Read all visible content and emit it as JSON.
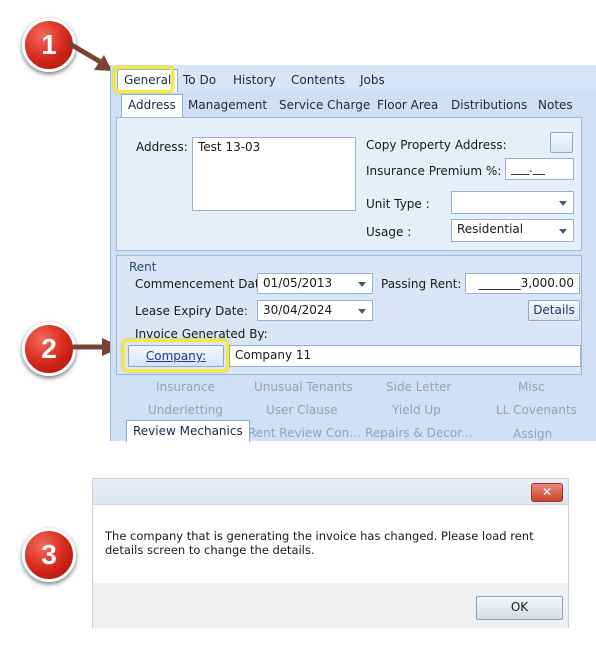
{
  "steps": [
    "1",
    "2",
    "3"
  ],
  "main_tabs": [
    {
      "label": "General",
      "active": true
    },
    {
      "label": "To Do"
    },
    {
      "label": "History"
    },
    {
      "label": "Contents"
    },
    {
      "label": "Jobs"
    }
  ],
  "sub_tabs": [
    {
      "label": "Address",
      "active": true
    },
    {
      "label": "Management"
    },
    {
      "label": "Service Charge"
    },
    {
      "label": "Floor Area"
    },
    {
      "label": "Distributions"
    },
    {
      "label": "Notes"
    }
  ],
  "address": {
    "label": "Address:",
    "value": "Test 13-03",
    "copy_label": "Copy Property Address:",
    "insurance_label": "Insurance Premium %:",
    "insurance_value": "___.__",
    "unit_type_label": "Unit Type :",
    "unit_type_value": "",
    "usage_label": "Usage :",
    "usage_value": "Residential"
  },
  "rent": {
    "section_label": "Rent",
    "commencement_label": "Commencement Date:",
    "commencement_value": "01/05/2013",
    "passing_rent_label": "Passing Rent:",
    "passing_rent_value": "_______3,000.00",
    "lease_expiry_label": "Lease Expiry Date:",
    "lease_expiry_value": "30/04/2024",
    "details_button": "Details",
    "invoice_label": "Invoice Generated By:",
    "company_button": "Company:",
    "company_value": "Company 11"
  },
  "bottom_links": {
    "row1": [
      "Insurance",
      "Unusual Tenants",
      "Side Letter",
      "Misc"
    ],
    "row2": [
      "Underletting",
      "User Clause",
      "Yield Up",
      "LL Covenants"
    ],
    "row3": [
      "Review Mechanics",
      "Rent Review Con...",
      "Repairs & Decor...",
      "Assign"
    ]
  },
  "dialog": {
    "close_symbol": "✕",
    "message": "The company that is generating the invoice has changed. Please load rent details screen to change the details.",
    "ok_label": "OK"
  },
  "colors": {
    "badge_red": "#d4241a",
    "highlight_yellow": "#f5ec3a",
    "arrow_brown": "#7a4232",
    "panel_blue": "#cfe0f5"
  }
}
